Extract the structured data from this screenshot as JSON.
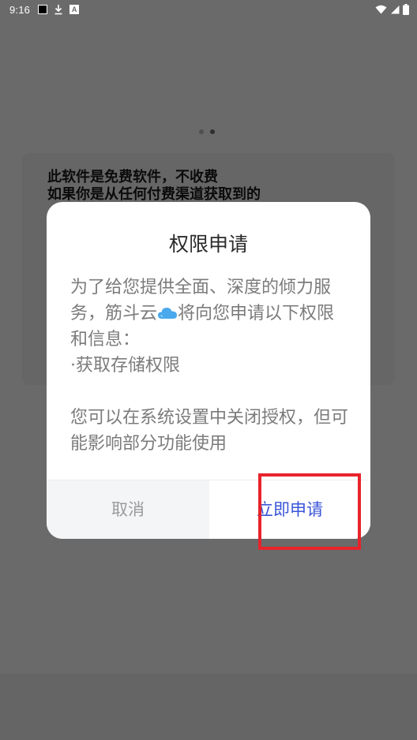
{
  "status_bar": {
    "time": "9:16",
    "icons": [
      "black-square-icon",
      "download-icon",
      "a-icon"
    ],
    "right_icons": [
      "wifi-icon",
      "signal-icon",
      "battery-icon"
    ],
    "a_label": "A"
  },
  "page_indicator": {
    "count": 2,
    "active": 1
  },
  "background_card": {
    "line1": "此软件是免费软件，不收费",
    "line2": "如果你是从任何付费渠道获取到的"
  },
  "dialog": {
    "title": "权限申请",
    "body_part1": "为了给您提供全面、深度的倾力服务，筋斗云",
    "body_part2": "将向您申请以下权限和信息：",
    "permission_item": "·获取存储权限",
    "note": "您可以在系统设置中关闭授权，但可能影响部分功能使用",
    "cancel_label": "取消",
    "confirm_label": "立即申请"
  },
  "colors": {
    "overlay": "#6a6a6a",
    "confirm_text": "#3a55d8",
    "cancel_bg": "#f4f5f7",
    "highlight": "#e8232b"
  }
}
